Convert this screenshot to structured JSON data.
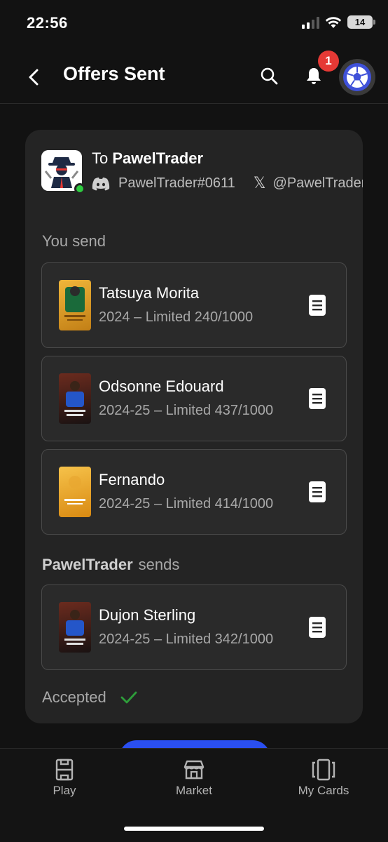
{
  "status_bar": {
    "time": "22:56",
    "battery": "14"
  },
  "header": {
    "title": "Offers Sent",
    "notification_count": "1"
  },
  "offer": {
    "to_prefix": "To",
    "trader_name": "PawelTrader",
    "discord_handle": "PawelTrader#0611",
    "x_handle": "@PawelTrader_",
    "you_send_label": "You send",
    "you_send": [
      {
        "name": "Tatsuya Morita",
        "meta": "2024 – Limited 240/1000",
        "card_color": "#d79a25"
      },
      {
        "name": "Odsonne Edouard",
        "meta": "2024-25 – Limited 437/1000",
        "card_color": "#3a1f1a"
      },
      {
        "name": "Fernando",
        "meta": "2024-25 – Limited 414/1000",
        "card_color": "#e6a021"
      }
    ],
    "they_send_name": "PawelTrader",
    "they_send_suffix": "sends",
    "they_send": [
      {
        "name": "Dujon Sterling",
        "meta": "2024-25 – Limited 342/1000",
        "card_color": "#3a1f1a"
      }
    ],
    "status": "Accepted"
  },
  "nav": {
    "play": "Play",
    "market": "Market",
    "my_cards": "My Cards"
  },
  "colors": {
    "accent_blue": "#2a4ff0",
    "badge_red": "#e53935",
    "online_green": "#2ecc40",
    "accepted_check": "#2e9d3a"
  }
}
